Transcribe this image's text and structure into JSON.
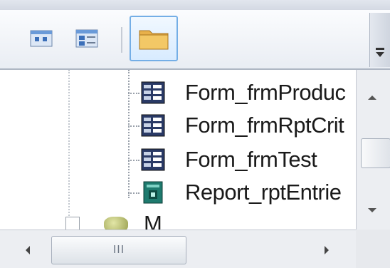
{
  "toolbar": {
    "buttons": [
      {
        "icon": "small-icons-view-icon"
      },
      {
        "icon": "list-view-icon"
      },
      {
        "icon": "folder-icon",
        "active": true
      }
    ]
  },
  "tree": {
    "items": [
      {
        "label": "Form_frmProduc",
        "icon": "form-icon"
      },
      {
        "label": "Form_frmRptCrit",
        "icon": "form-icon"
      },
      {
        "label": "Form_frmTest",
        "icon": "form-icon"
      },
      {
        "label": "Report_rptEntrie",
        "icon": "report-icon"
      }
    ],
    "partial_item": {
      "label": "M",
      "icon": "module-icon"
    }
  },
  "scrollbar": {
    "grip": "III"
  },
  "colors": {
    "accent": "#74aee6",
    "form_icon": "#2a3a66",
    "report_icon": "#1e7a6e"
  }
}
